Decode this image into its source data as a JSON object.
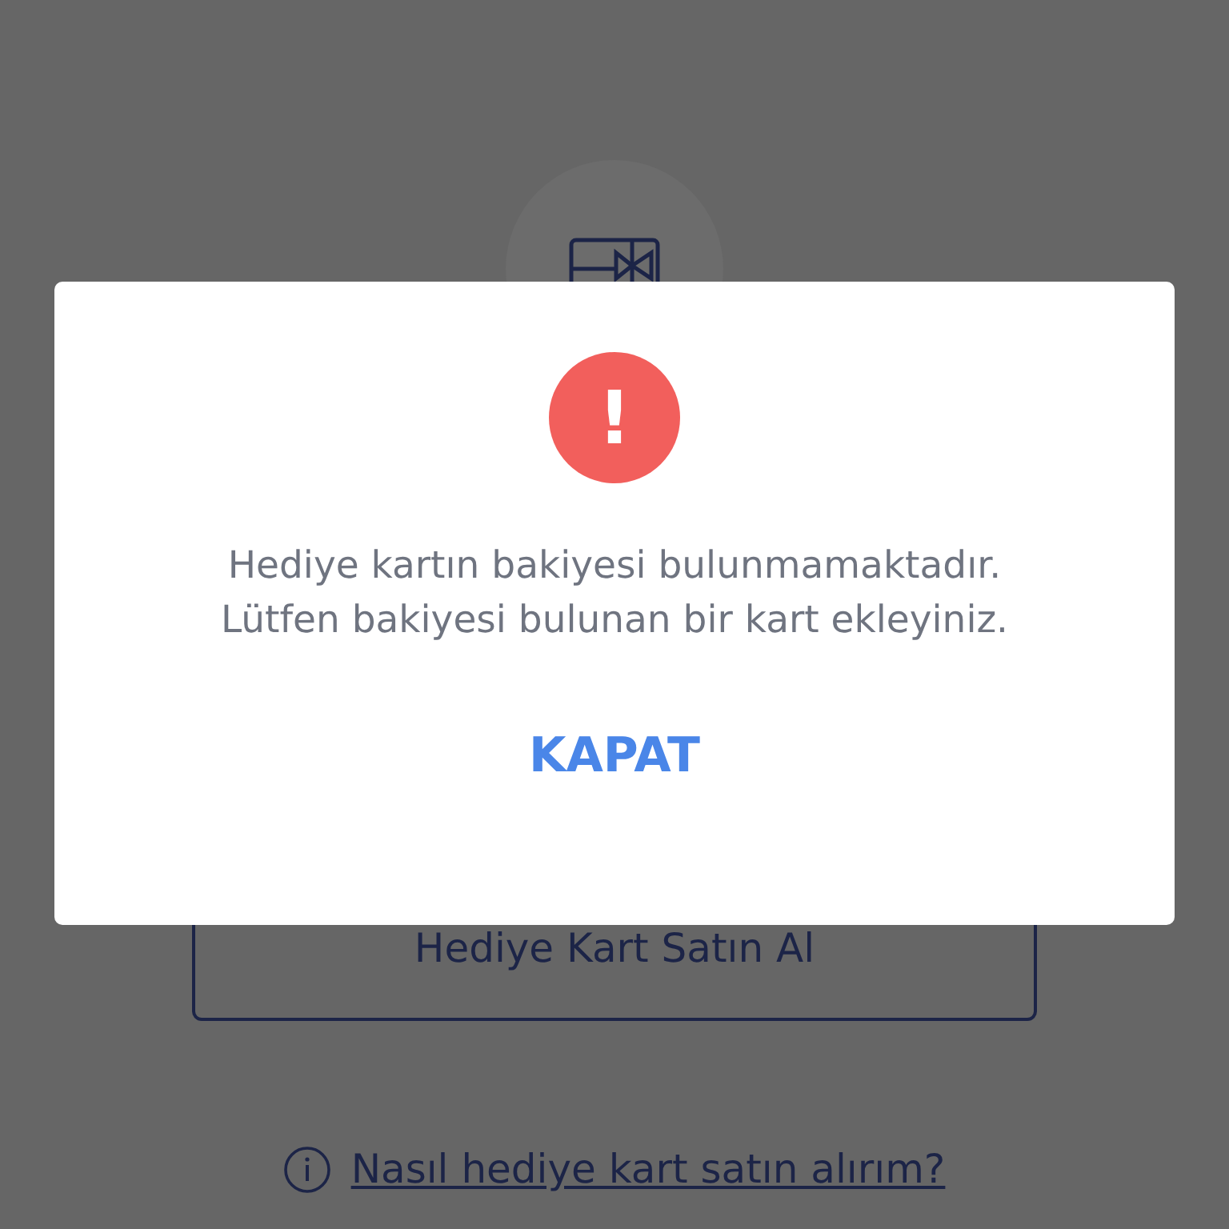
{
  "background": {
    "buy_button": "Hediye Kart Satın Al",
    "help_link": "Nasıl hediye kart satın alırım?"
  },
  "dialog": {
    "icon": "!",
    "message_lines": [
      "Hediye kartın bakiyesi bulunmamaktadır.",
      "Lütfen bakiyesi bulunan bir kart ekleyiniz."
    ],
    "close_button": "KAPAT"
  }
}
